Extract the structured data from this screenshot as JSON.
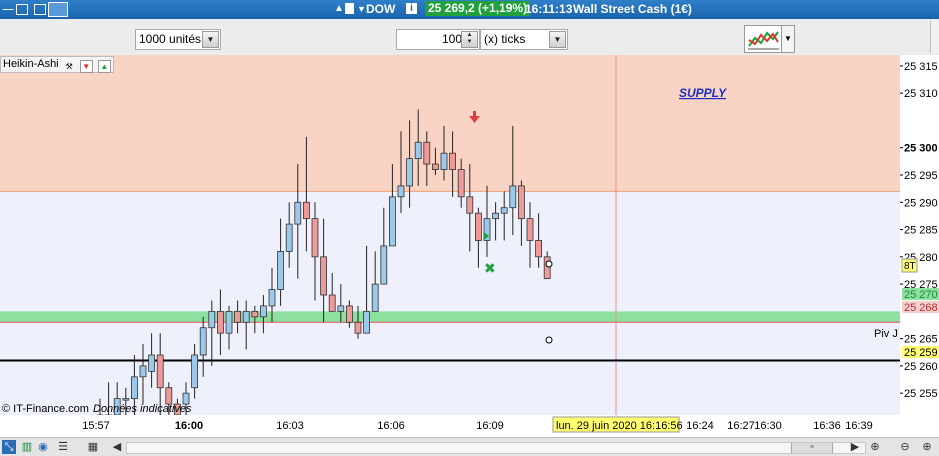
{
  "window": {
    "symbol_arrows": "▲▼",
    "symbol": "DOW",
    "price": "25 269,2 (+1,19%)",
    "time": "16:11:13",
    "instrument": "Wall Street Cash (1€)"
  },
  "toolbar": {
    "quantity": "1000 unités",
    "step_value": "100",
    "step_unit": "(x) ticks"
  },
  "indicator": {
    "name": "Heikin-Ashi"
  },
  "zones": {
    "supply_label": "SUPPLY",
    "pivot_label": "Piv J"
  },
  "price_axis": {
    "ticks": [
      "25 315",
      "25 310",
      "25 300",
      "25 295",
      "25 290",
      "25 285",
      "25 280",
      "25 275",
      "25 270",
      "25 268",
      "25 265",
      "25 260",
      "25 259",
      "25 255"
    ],
    "current_marker": "8T",
    "tag_green": "25 270",
    "tag_red": "25 268",
    "tag_yellow": "25 259"
  },
  "time_axis": {
    "labels": [
      "15:57",
      "16:00",
      "16:03",
      "16:06",
      "16:09",
      "16:24",
      "16:27",
      "16:30",
      "16:36",
      "16:39"
    ],
    "cursor_label": "lun. 29 juin 2020 16:16:56"
  },
  "credits": {
    "source": "© IT-Finance.com",
    "data": "Données indicatives"
  },
  "chart_data": {
    "type": "candlestick",
    "ylim": [
      25251,
      25317
    ],
    "supply_zone": [
      25292,
      25317
    ],
    "demand_zone": [
      25268,
      25270
    ],
    "pivot_level": 25261,
    "candles": [
      [
        25251,
        25251,
        25250,
        25254
      ],
      [
        25249,
        25251,
        25248,
        25257
      ],
      [
        25251,
        25254,
        25249,
        25257
      ],
      [
        25254,
        25254,
        25251,
        25256
      ],
      [
        25254,
        25258,
        25251,
        25262
      ],
      [
        25258,
        25260,
        25253,
        25264
      ],
      [
        25259,
        25262,
        25256,
        25266
      ],
      [
        25262,
        25256,
        25250,
        25266
      ],
      [
        25256,
        25253,
        25250,
        25257
      ],
      [
        25253,
        25251,
        25248,
        25254
      ],
      [
        25253,
        25255,
        25250,
        25257
      ],
      [
        25256,
        25262,
        25254,
        25264
      ],
      [
        25262,
        25267,
        25258,
        25269
      ],
      [
        25267,
        25270,
        25260,
        25272
      ],
      [
        25270,
        25266,
        25262,
        25274
      ],
      [
        25266,
        25270,
        25263,
        25271
      ],
      [
        25270,
        25268,
        25266,
        25272
      ],
      [
        25268,
        25270,
        25263,
        25272
      ],
      [
        25270,
        25269,
        25266,
        25271
      ],
      [
        25269,
        25271,
        25266,
        25273
      ],
      [
        25271,
        25274,
        25268,
        25278
      ],
      [
        25274,
        25281,
        25271,
        25287
      ],
      [
        25281,
        25286,
        25278,
        25290
      ],
      [
        25286,
        25290,
        25276,
        25297
      ],
      [
        25290,
        25287,
        25281,
        25302
      ],
      [
        25287,
        25280,
        25272,
        25290
      ],
      [
        25280,
        25273,
        25268,
        25287
      ],
      [
        25273,
        25270,
        25270,
        25277
      ],
      [
        25270,
        25271,
        25268,
        25275
      ],
      [
        25271,
        25268,
        25267,
        25272
      ],
      [
        25268,
        25266,
        25265,
        25271
      ],
      [
        25266,
        25270,
        25268,
        25282
      ],
      [
        25270,
        25275,
        25272,
        25281
      ],
      [
        25275,
        25282,
        25275,
        25289
      ],
      [
        25282,
        25291,
        25282,
        25297
      ],
      [
        25291,
        25293,
        25288,
        25303
      ],
      [
        25293,
        25298,
        25289,
        25305
      ],
      [
        25298,
        25301,
        25293,
        25307
      ],
      [
        25301,
        25297,
        25293,
        25303
      ],
      [
        25297,
        25296,
        25295,
        25300
      ],
      [
        25296,
        25299,
        25294,
        25304
      ],
      [
        25299,
        25296,
        25291,
        25303
      ],
      [
        25296,
        25291,
        25289,
        25298
      ],
      [
        25291,
        25288,
        25281,
        25297
      ],
      [
        25288,
        25283,
        25278,
        25289
      ],
      [
        25283,
        25287,
        25280,
        25293
      ],
      [
        25287,
        25288,
        25283,
        25290
      ],
      [
        25288,
        25289,
        25283,
        25292
      ],
      [
        25289,
        25293,
        25284,
        25304
      ],
      [
        25293,
        25287,
        25282,
        25294
      ],
      [
        25287,
        25283,
        25278,
        25290
      ],
      [
        25283,
        25280,
        25278,
        25288
      ],
      [
        25280,
        25276,
        25276,
        25281
      ]
    ]
  }
}
